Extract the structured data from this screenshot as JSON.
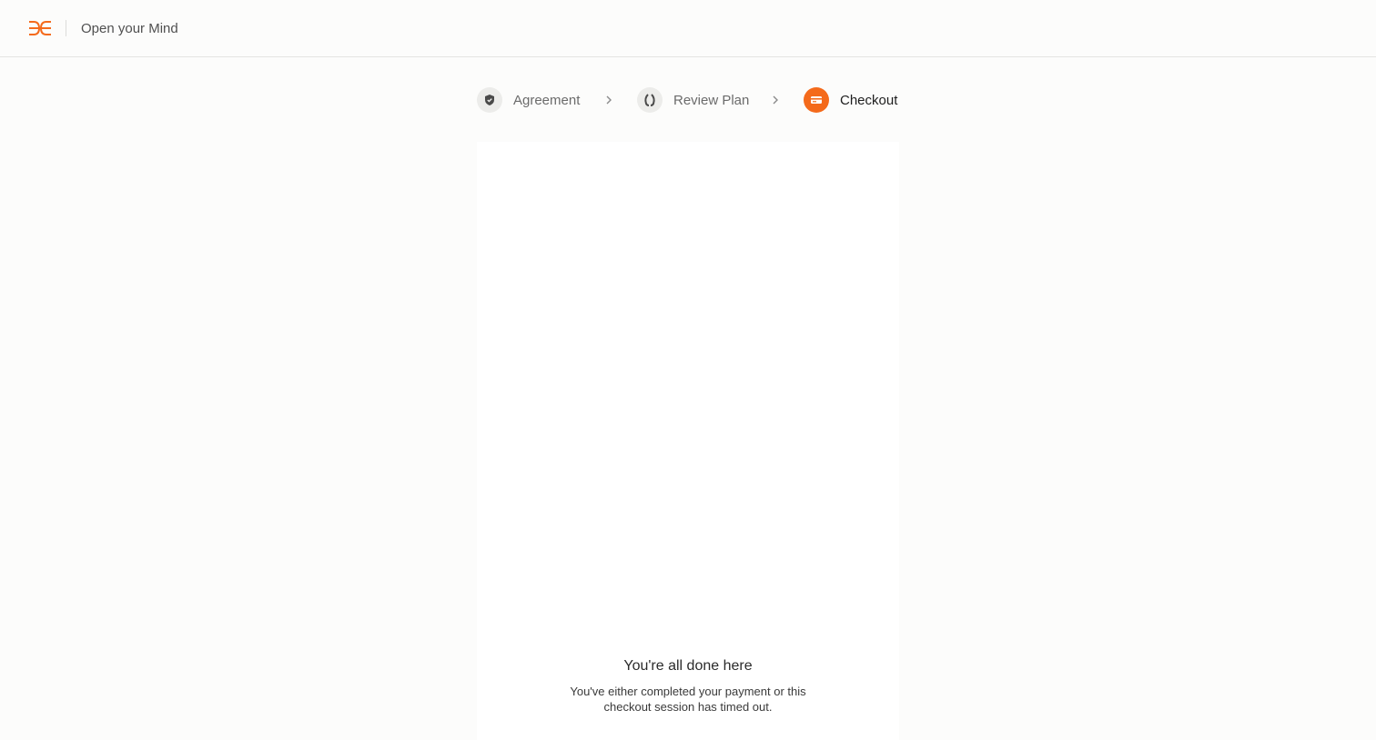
{
  "header": {
    "brand_title": "Open your Mind",
    "logo_icon": "brand-logo-icon",
    "accent_color": "#f46a1b"
  },
  "steps": [
    {
      "label": "Agreement",
      "icon": "shield-check-icon",
      "state": "completed"
    },
    {
      "label": "Review Plan",
      "icon": "laurel-icon",
      "state": "completed"
    },
    {
      "label": "Checkout",
      "icon": "credit-card-icon",
      "state": "active"
    }
  ],
  "checkout": {
    "title": "You're all done here",
    "message": "You've either completed your payment or this checkout session has timed out."
  }
}
